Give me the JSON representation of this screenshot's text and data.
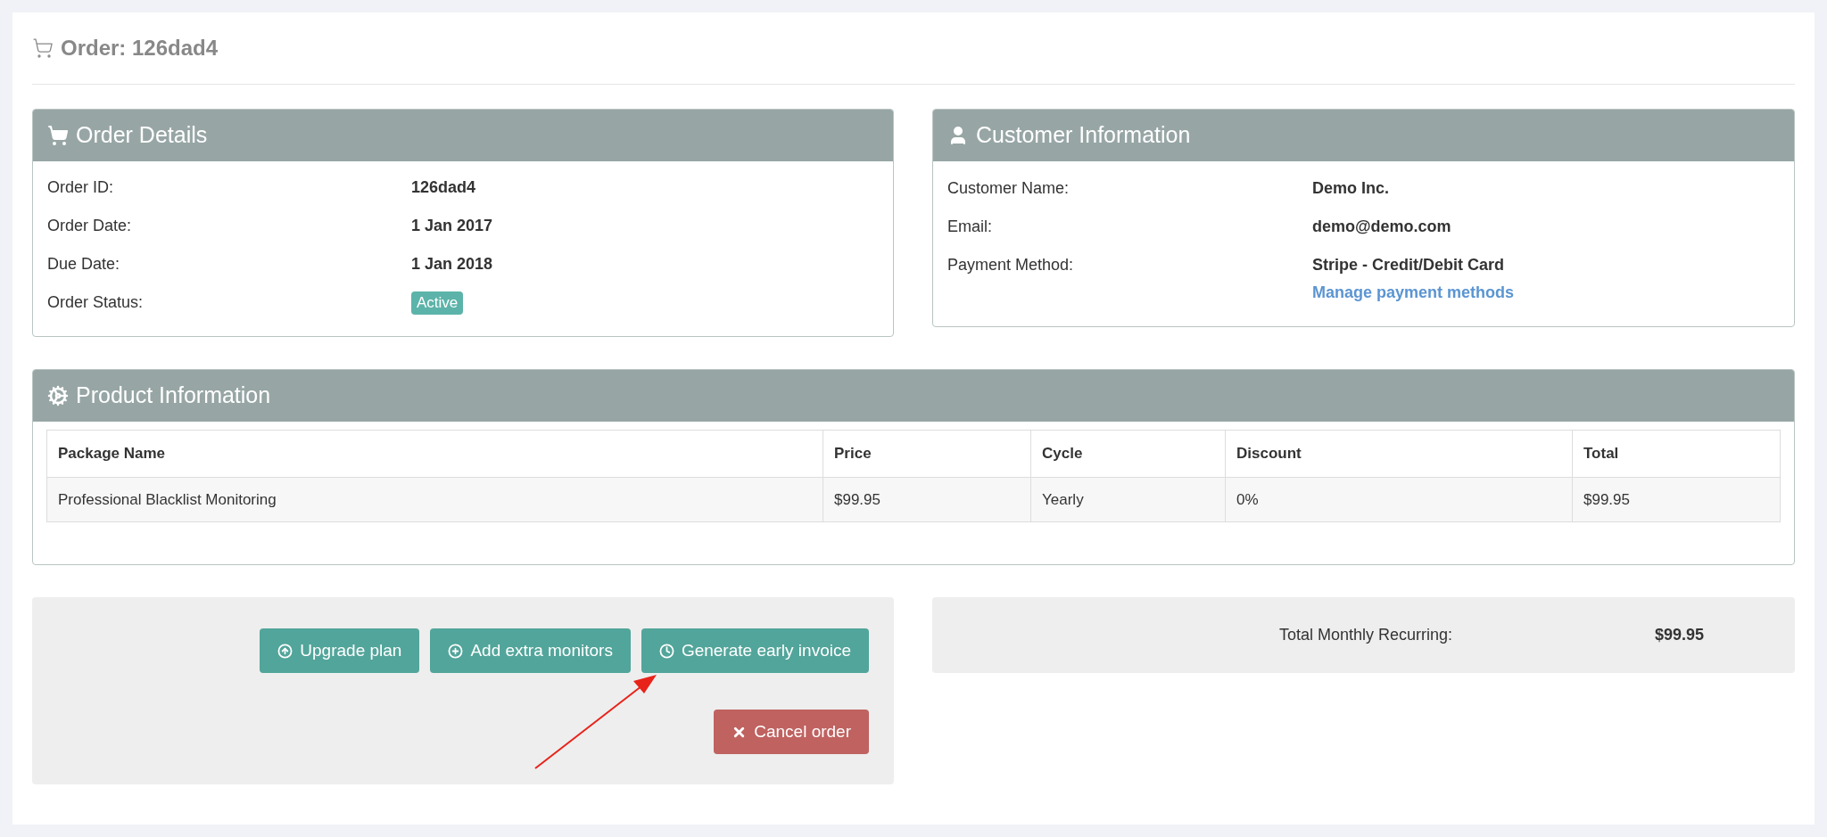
{
  "page_title": "Order: 126dad4",
  "order_details": {
    "title": "Order Details",
    "rows": [
      {
        "label": "Order ID:",
        "value": "126dad4",
        "kind": "text"
      },
      {
        "label": "Order Date:",
        "value": "1 Jan 2017",
        "kind": "text"
      },
      {
        "label": "Due Date:",
        "value": "1 Jan 2018",
        "kind": "text"
      },
      {
        "label": "Order Status:",
        "value": "Active",
        "kind": "badge"
      }
    ]
  },
  "customer_information": {
    "title": "Customer Information",
    "rows": [
      {
        "label": "Customer Name:",
        "value": "Demo Inc."
      },
      {
        "label": "Email:",
        "value": "demo@demo.com"
      },
      {
        "label": "Payment Method:",
        "value": "Stripe - Credit/Debit Card",
        "link": "Manage payment methods"
      }
    ]
  },
  "product_information": {
    "title": "Product Information",
    "table": {
      "columns": [
        "Package Name",
        "Price",
        "Cycle",
        "Discount",
        "Total"
      ],
      "rows": [
        [
          "Professional Blacklist Monitoring",
          "$99.95",
          "Yearly",
          "0%",
          "$99.95"
        ]
      ]
    }
  },
  "actions": [
    {
      "label": "Upgrade plan",
      "kind": "upgrade"
    },
    {
      "label": "Add extra monitors",
      "kind": "add"
    },
    {
      "label": "Generate early invoice",
      "kind": "invoice"
    },
    {
      "label": "Cancel order",
      "kind": "cancel"
    }
  ],
  "summary": {
    "label": "Total Monthly Recurring:",
    "value": "$99.95"
  }
}
